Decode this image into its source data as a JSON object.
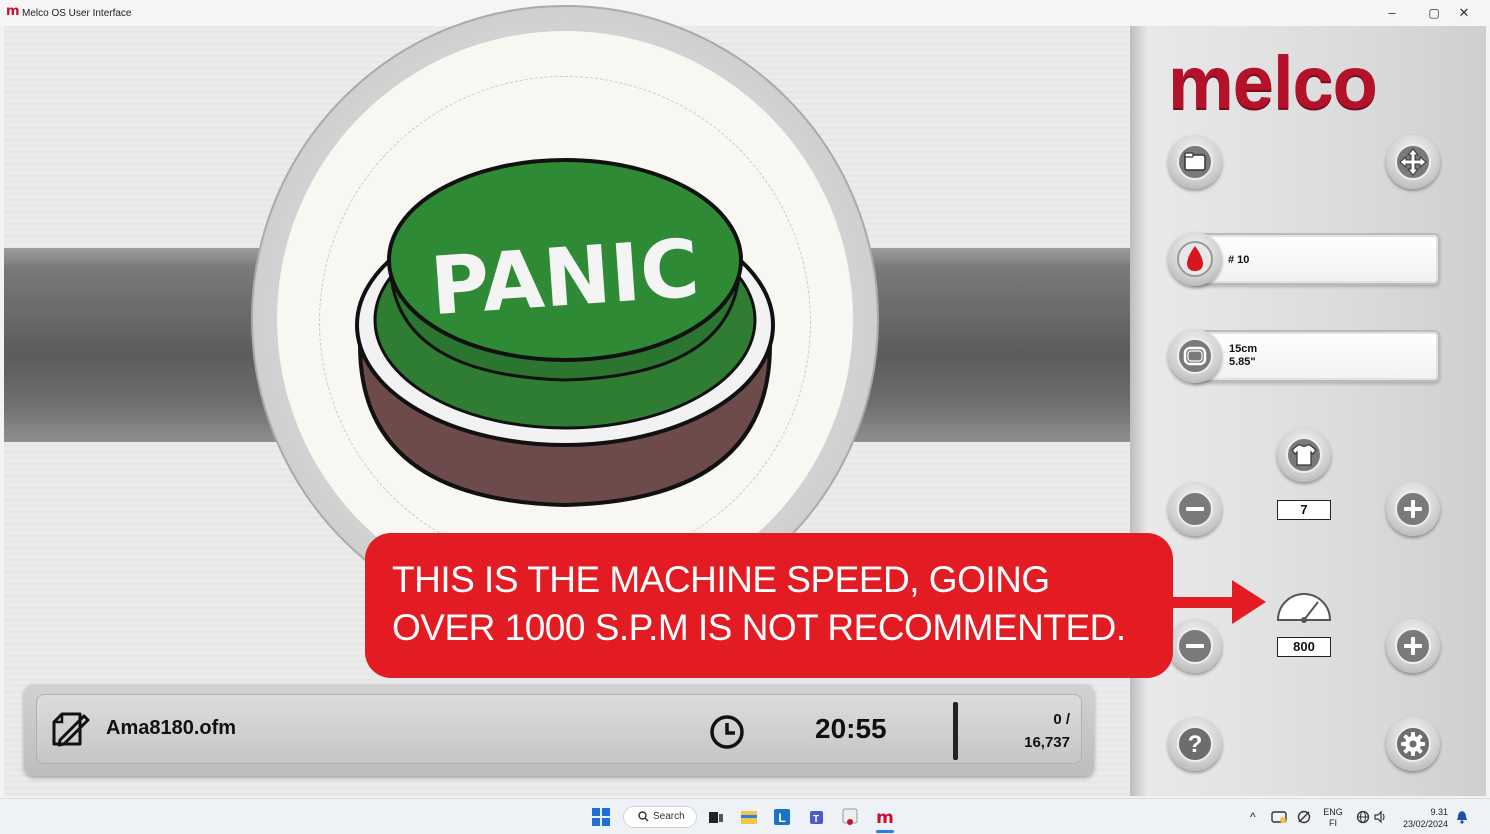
{
  "window": {
    "title": "Melco OS User Interface",
    "logo_letter": "m",
    "minimize": "–",
    "maximize": "▢",
    "close": "✕"
  },
  "brand": {
    "name": "melco",
    "color": "#b3122a"
  },
  "design": {
    "text": "PANIC",
    "button_color": "#2e7d32",
    "base_color": "#6d4b4b"
  },
  "panel": {
    "needle_label": "# 10",
    "hoop_size_cm": "15cm",
    "hoop_size_in": "5.85\"",
    "garment_value": "7",
    "speed_value": "800",
    "help_glyph": "?",
    "buttons": [
      "folder-button",
      "move-button",
      "minus",
      "plus",
      "help",
      "settings"
    ]
  },
  "status": {
    "filename": "Ama8180.ofm",
    "time": "20:55",
    "stitch_current": "0 /",
    "stitch_total": "16,737"
  },
  "callout": {
    "line1": "THIS IS THE MACHINE SPEED, GOING",
    "line2": "OVER 1000 S.P.M IS NOT RECOMMENTED.",
    "color": "#e31b23"
  },
  "taskbar": {
    "search_label": "Search",
    "lang_top": "ENG",
    "lang_bottom": "FI",
    "clock_time": "9.31",
    "clock_date": "23/02/2024",
    "chevron": "^"
  }
}
